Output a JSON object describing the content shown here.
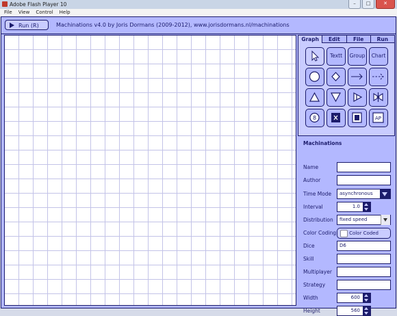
{
  "window": {
    "title": "Adobe Flash Player 10"
  },
  "window_controls": {
    "minimize": "–",
    "maximize": "□",
    "close": "✕"
  },
  "menu": [
    "File",
    "View",
    "Control",
    "Help"
  ],
  "toolbar": {
    "run_label": "Run (R)",
    "app_title": "Machinations v4.0 by Joris Dormans (2009-2012), www.jorisdormans.nl/machinations"
  },
  "tabs": [
    "Graph",
    "Edit",
    "File",
    "Run"
  ],
  "tools": {
    "text_label": "Textt",
    "group_label": "Group",
    "chart_label": "Chart",
    "ap_label": "AP",
    "icons": [
      "pointer-icon",
      "text-tool",
      "group-tool",
      "chart-tool",
      "pool-icon",
      "gate-icon",
      "resource-connection-icon",
      "state-connection-icon",
      "source-icon",
      "drain-icon",
      "converter-icon",
      "trader-icon",
      "register-icon",
      "delay-icon",
      "end-condition-icon",
      "artificial-player-icon"
    ]
  },
  "props": {
    "header": "Machinations",
    "labels": {
      "name": "Name",
      "author": "Author",
      "time_mode": "Time Mode",
      "interval": "Interval",
      "distribution": "Distribution",
      "color_coding": "Color Coding",
      "dice": "Dice",
      "skill": "Skill",
      "multiplayer": "Multiplayer",
      "strategy": "Strategy",
      "width": "Width",
      "height": "Height"
    },
    "values": {
      "name": "",
      "author": "",
      "time_mode": "asynchronous",
      "interval": "1.0",
      "distribution": "fixed speed",
      "color_coding": "Color Coded",
      "dice": "D6",
      "skill": "",
      "multiplayer": "",
      "strategy": "",
      "width": "600",
      "height": "560"
    }
  },
  "colors": {
    "panel": "#b3b8ff",
    "dark": "#1c1c6b",
    "grid": "#c3c3e8"
  }
}
